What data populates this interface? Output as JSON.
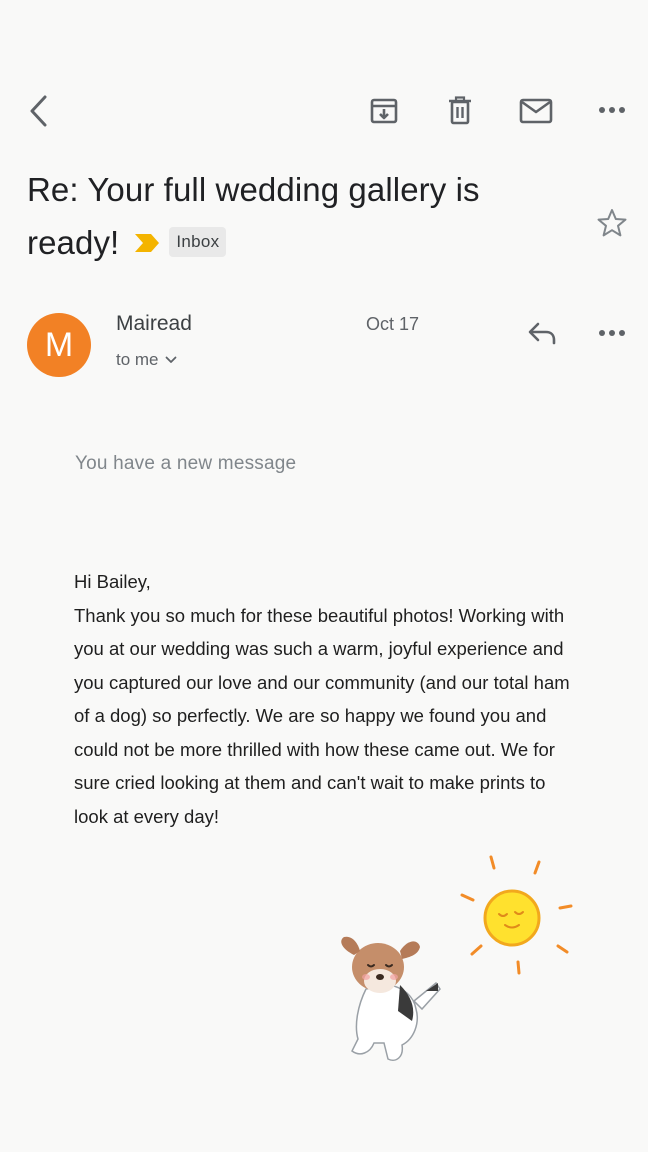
{
  "toolbar": {
    "back_icon": "chevron-left-icon",
    "archive_icon": "archive-icon",
    "delete_icon": "trash-icon",
    "mark_unread_icon": "mail-icon",
    "more_icon": "more-horizontal-icon"
  },
  "email": {
    "subject": "Re: Your full wedding gallery is ready!",
    "label": "Inbox",
    "important_color": "#f4b400",
    "sender": {
      "initial": "M",
      "name": "Mairead",
      "avatar_color": "#f28125",
      "recipient": "to me",
      "date": "Oct 17"
    },
    "notice": "You have a new message",
    "body": {
      "greeting": "Hi Bailey,",
      "paragraph": "Thank you so much for these beautiful photos! Working with you at our wedding was such a warm, joyful experience and you captured our love and our community (and our total ham of a dog) so perfectly. We are so happy we found you and could not be more thrilled with how these came out. We for sure cried looking at them and can't wait to make prints to look at every day!"
    }
  }
}
